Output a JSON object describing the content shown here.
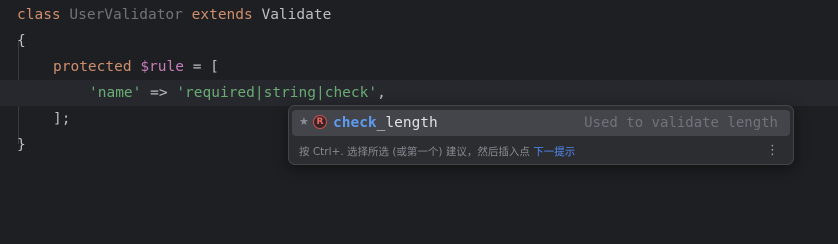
{
  "code": {
    "line1": {
      "kw_class": "class",
      "class_name": "UserValidator",
      "kw_extends": "extends",
      "parent": "Validate"
    },
    "line2": {
      "text": "{"
    },
    "line3": {
      "kw_protected": "protected",
      "var": "$rule",
      "rest": " = ["
    },
    "line4": {
      "key": "'name'",
      "arrow": " => ",
      "value": "'required|string|check'",
      "comma": ","
    },
    "line5": {
      "text": "];"
    },
    "line6": {
      "text": "}"
    }
  },
  "completion": {
    "star": "★",
    "icon_letter": "R",
    "icon_name": "rule-icon",
    "name_match": "check",
    "name_rest": "_length",
    "description": "Used to validate length",
    "hint_text": "按 Ctrl+. 选择所选 (或第一个) 建议，然后插入点 ",
    "hint_link": "下一提示",
    "menu_glyph": "⋮"
  },
  "colors": {
    "background": "#1e1f22",
    "keyword": "#cf8e6d",
    "string": "#6aab73",
    "variable": "#c77dbb",
    "match": "#5d9bef",
    "popup_bg": "#2b2d30",
    "selection": "#43454a"
  }
}
